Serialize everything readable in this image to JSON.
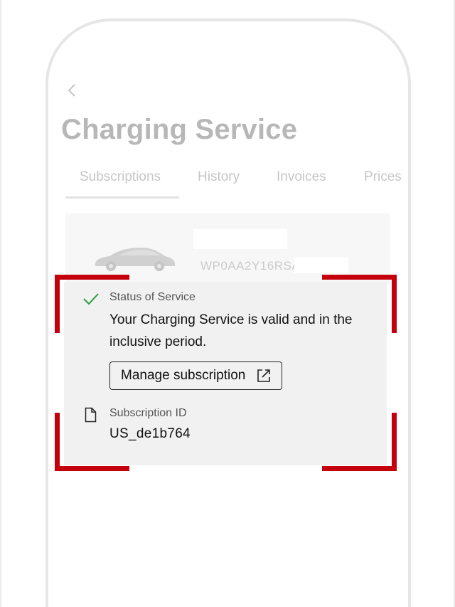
{
  "header": {
    "back_icon": "chevron-left-icon",
    "title": "Charging Service"
  },
  "tabs": [
    {
      "label": "Subscriptions",
      "active": true
    },
    {
      "label": "History",
      "active": false
    },
    {
      "label": "Invoices",
      "active": false
    },
    {
      "label": "Prices",
      "active": false
    }
  ],
  "vehicle": {
    "image": "car-icon",
    "vin": "WP0AA2Y16RSA"
  },
  "status": {
    "icon": "checkmark-icon",
    "label": "Status of Service",
    "text": "Your Charging Service is valid and in the inclusive period.",
    "button_label": "Manage subscription",
    "button_icon": "external-link-icon"
  },
  "subscription": {
    "icon": "document-icon",
    "label": "Subscription ID",
    "id": "US_de1b764"
  },
  "colors": {
    "accent": "#c4000d",
    "check": "#2e9e3c",
    "card_bg": "#f1f1f1"
  }
}
